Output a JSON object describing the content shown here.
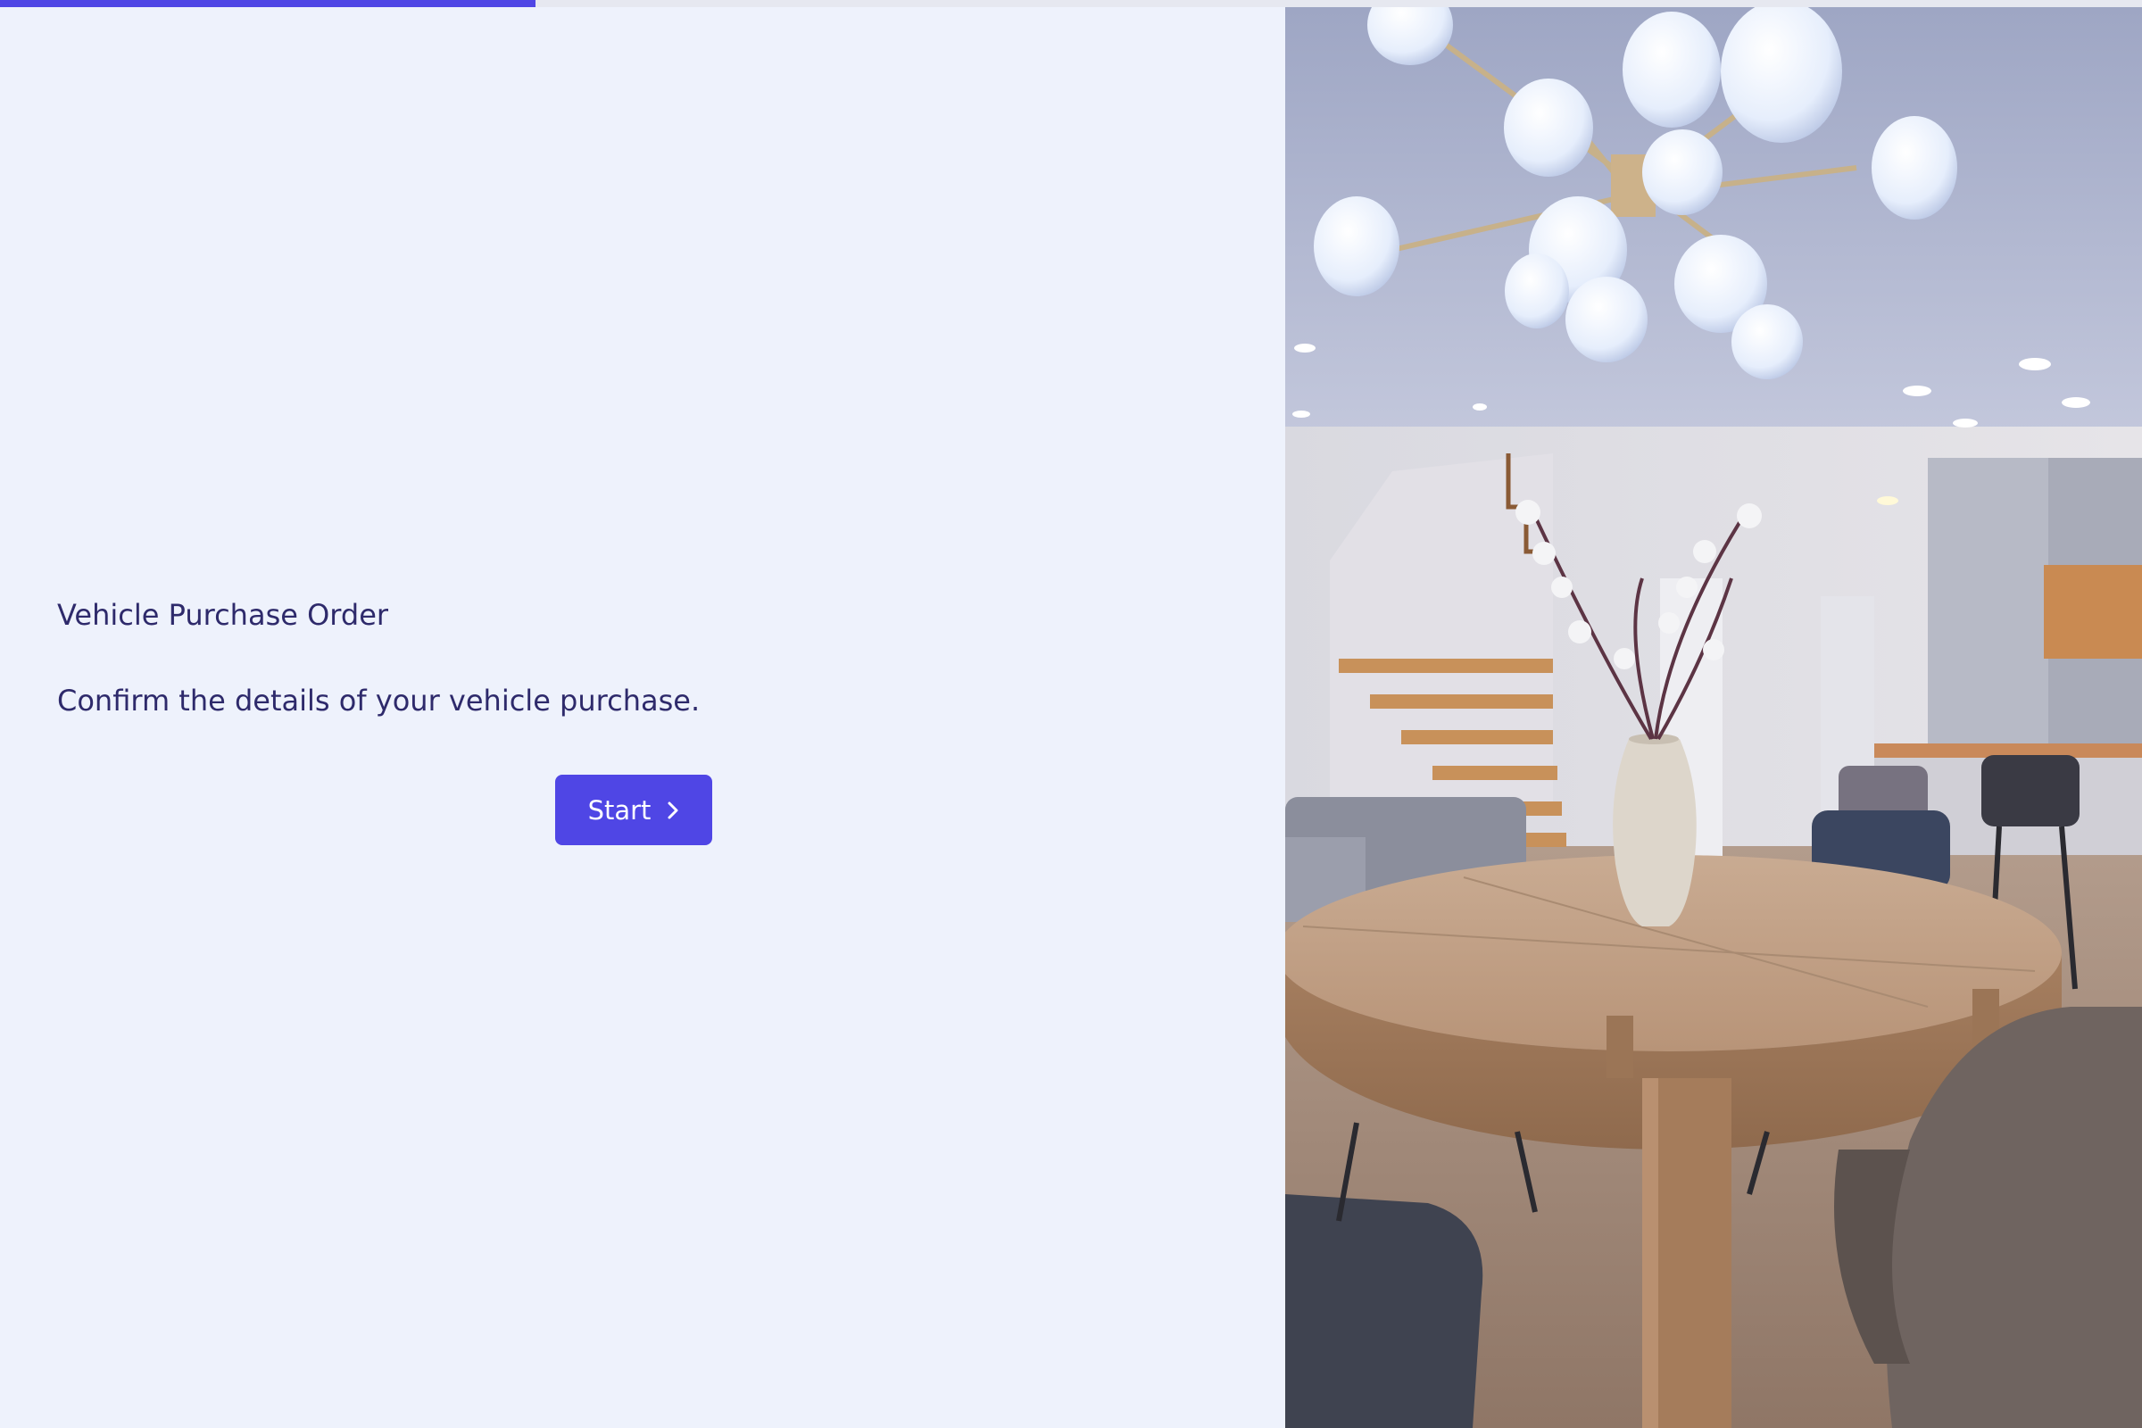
{
  "progress": {
    "fraction": 0.25,
    "color": "#4f46e5"
  },
  "form": {
    "title": "Vehicle Purchase Order",
    "subtitle": "Confirm the details of your vehicle purchase.",
    "start_label": "Start",
    "start_icon": "chevron-right-icon"
  },
  "hero_image": {
    "subject": "dining-room-photo"
  },
  "colors": {
    "background": "#eef2fc",
    "text": "#2e2a6b",
    "accent": "#4f46e5"
  }
}
